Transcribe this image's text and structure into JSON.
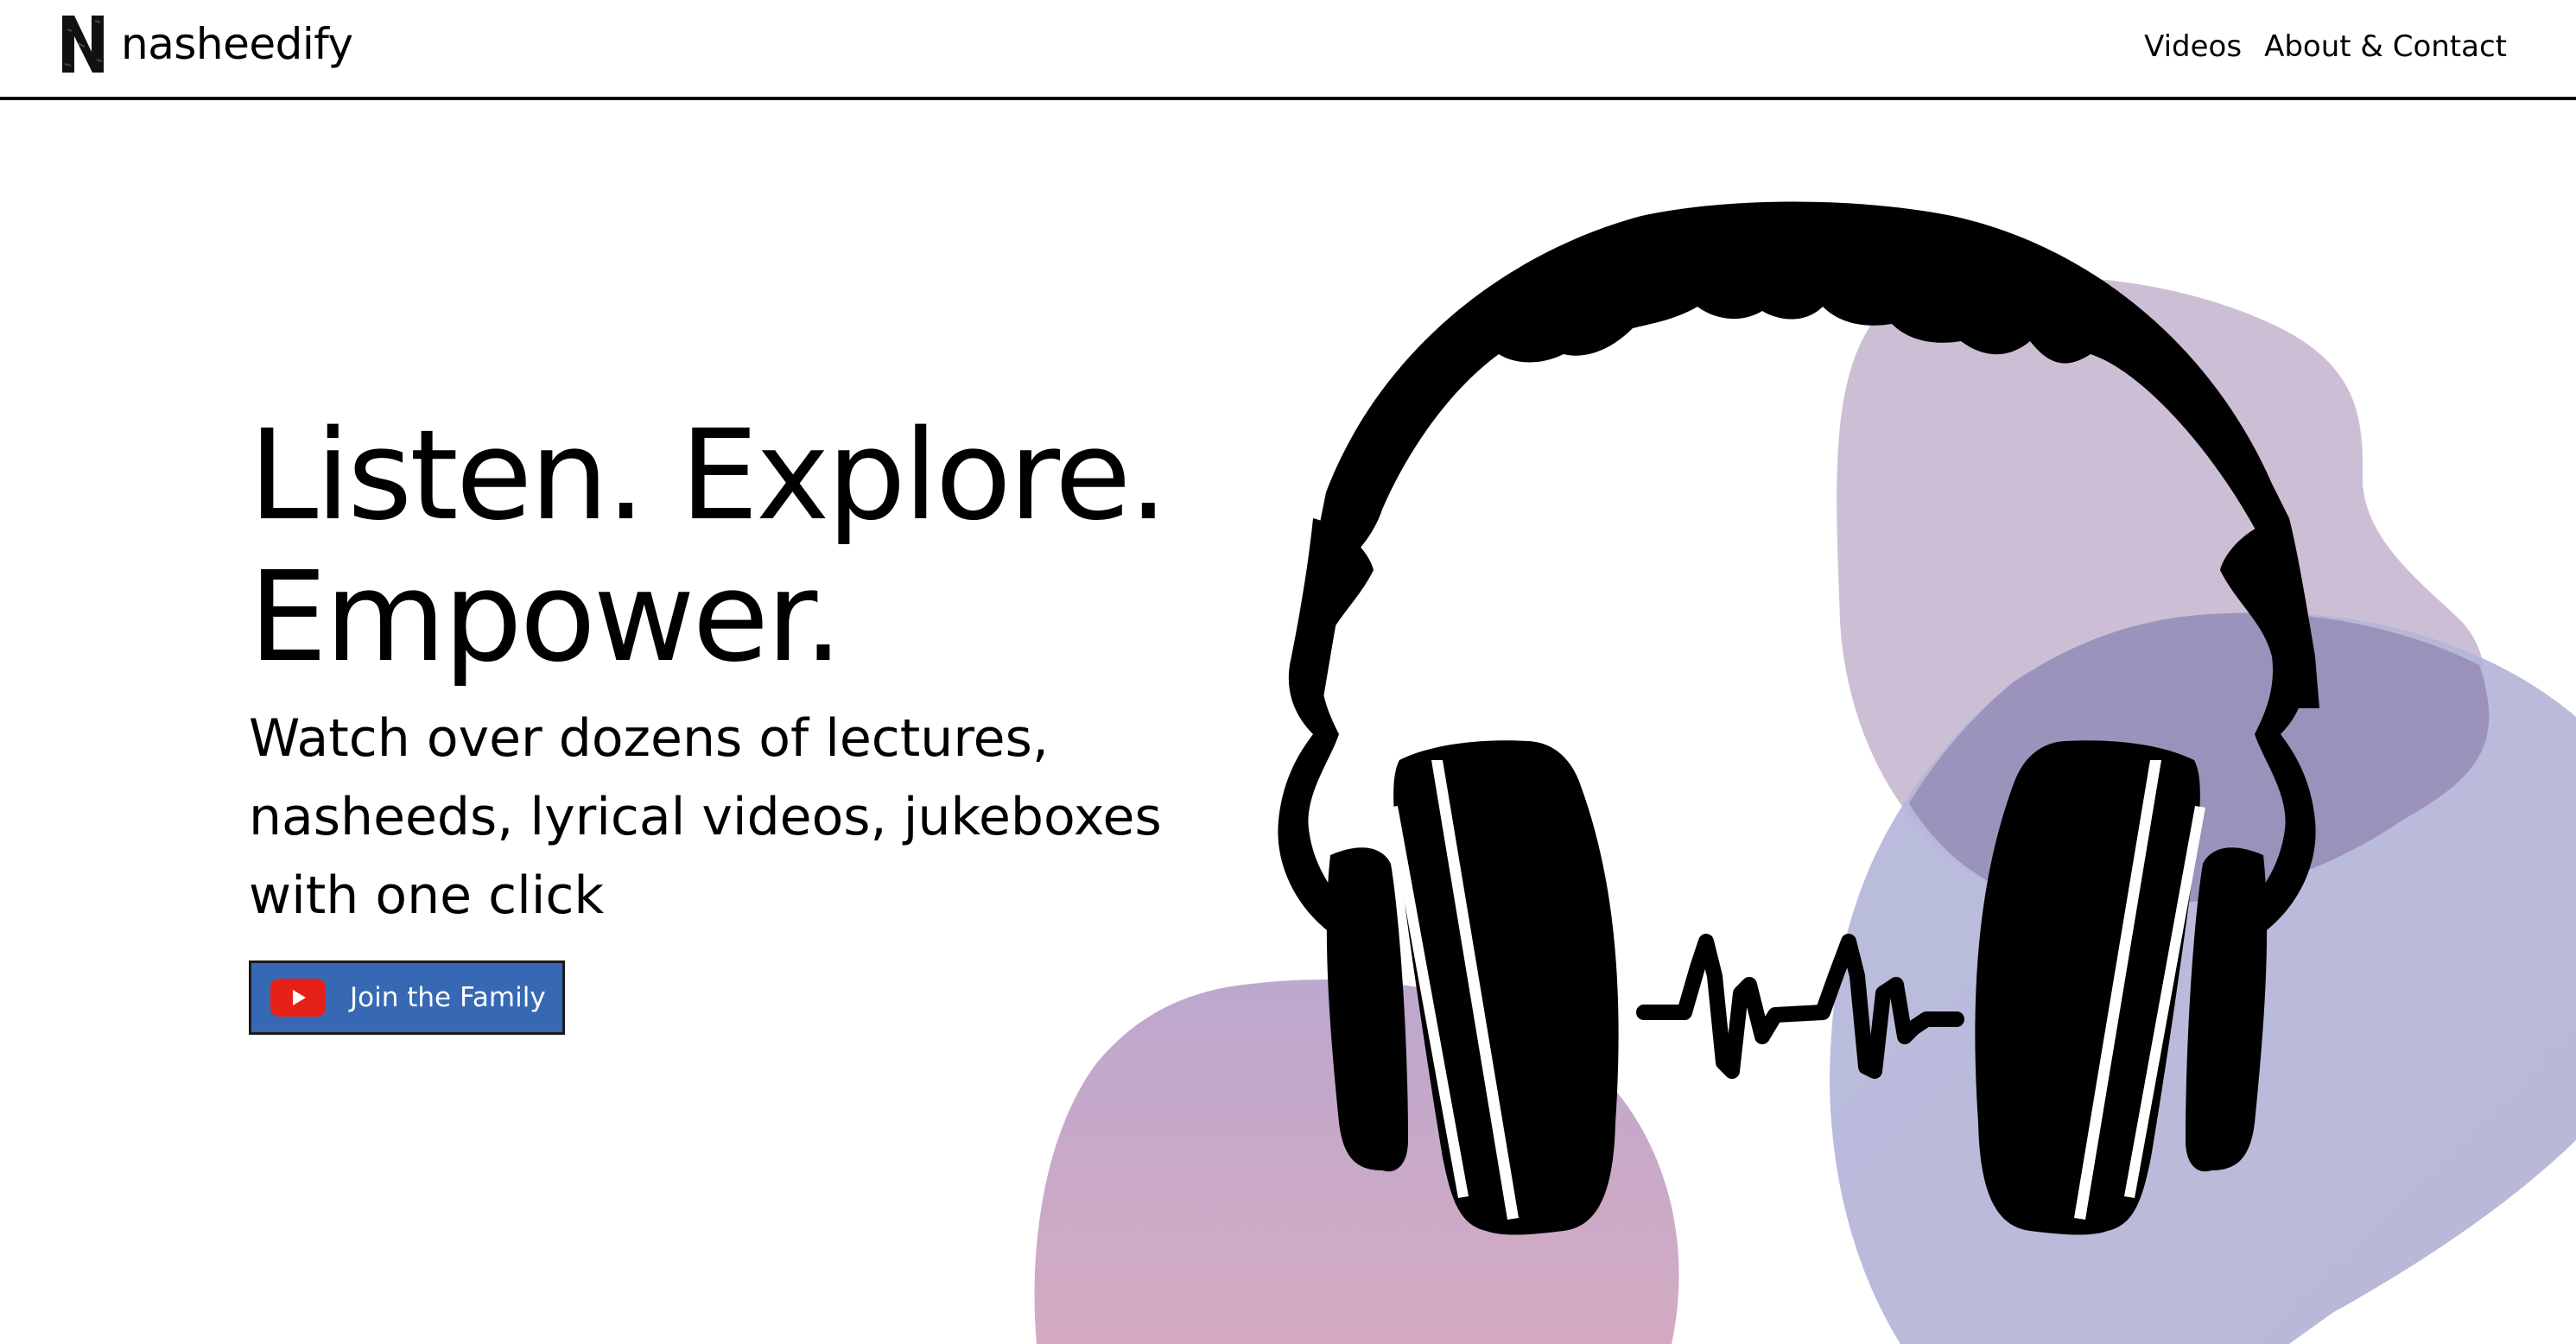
{
  "brand": {
    "logo_letter": "N",
    "name": "nasheedify",
    "logo_icon": "n-logo-icon"
  },
  "nav": {
    "items": [
      {
        "label": "Videos"
      },
      {
        "label": "About & Contact"
      }
    ]
  },
  "hero": {
    "headline_line1": "Listen. Explore.",
    "headline_line2": "Empower.",
    "subtitle_line1": "Watch over dozens of lectures,",
    "subtitle_line2": "nasheeds, lyrical videos, jukeboxes",
    "subtitle_line3": "with one click",
    "cta_label": "Join the Family",
    "cta_icon": "youtube-icon"
  },
  "art": {
    "illustration_icon": "headphones-icon",
    "waveform_icon": "sound-wave-icon"
  },
  "colors": {
    "cta_background": "#3768b4",
    "youtube_red": "#e62117",
    "blob_mauve": "#c8bcd3",
    "blob_pink": "#c7a0c4",
    "blob_periwinkle": "#afb3d6",
    "header_rule": "#000000"
  }
}
